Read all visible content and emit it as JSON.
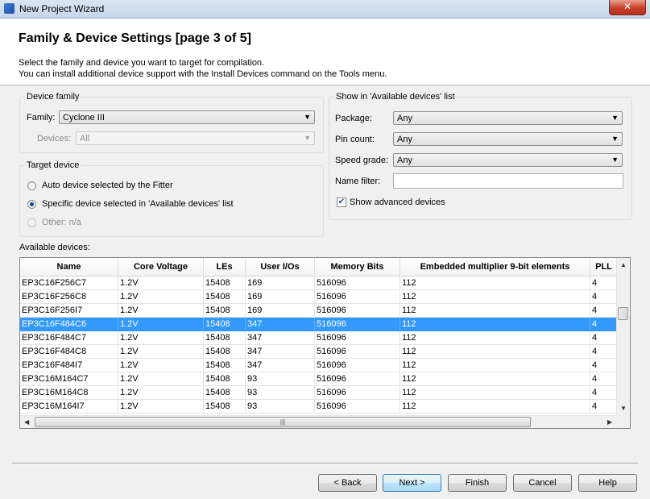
{
  "window": {
    "title": "New Project Wizard",
    "close_glyph": "✕"
  },
  "header": {
    "title": "Family & Device Settings [page 3 of 5]",
    "desc1": "Select the family and device you want to target for compilation.",
    "desc2": "You can install additional device support with the Install Devices command on the Tools menu."
  },
  "device_family": {
    "legend": "Device family",
    "family_label": "Family:",
    "family_value": "Cyclone III",
    "devices_label": "Devices:",
    "devices_value": "All"
  },
  "target_device": {
    "legend": "Target device",
    "auto_label": "Auto device selected by the Fitter",
    "specific_label": "Specific device selected in 'Available devices' list",
    "other_label": "Other:  n/a"
  },
  "show_filter": {
    "legend": "Show in 'Available devices' list",
    "package_label": "Package:",
    "package_value": "Any",
    "pin_label": "Pin count:",
    "pin_value": "Any",
    "speed_label": "Speed grade:",
    "speed_value": "Any",
    "name_filter_label": "Name filter:",
    "name_filter_value": "",
    "advanced_label": "Show advanced devices",
    "advanced_checked": true
  },
  "available_devices": {
    "label": "Available devices:",
    "columns": [
      "Name",
      "Core Voltage",
      "LEs",
      "User I/Os",
      "Memory Bits",
      "Embedded multiplier 9-bit elements",
      "PLL"
    ],
    "rows": [
      [
        "EP3C16F256C7",
        "1.2V",
        "15408",
        "169",
        "516096",
        "112",
        "4"
      ],
      [
        "EP3C16F256C8",
        "1.2V",
        "15408",
        "169",
        "516096",
        "112",
        "4"
      ],
      [
        "EP3C16F256I7",
        "1.2V",
        "15408",
        "169",
        "516096",
        "112",
        "4"
      ],
      [
        "EP3C16F484C6",
        "1.2V",
        "15408",
        "347",
        "516096",
        "112",
        "4"
      ],
      [
        "EP3C16F484C7",
        "1.2V",
        "15408",
        "347",
        "516096",
        "112",
        "4"
      ],
      [
        "EP3C16F484C8",
        "1.2V",
        "15408",
        "347",
        "516096",
        "112",
        "4"
      ],
      [
        "EP3C16F484I7",
        "1.2V",
        "15408",
        "347",
        "516096",
        "112",
        "4"
      ],
      [
        "EP3C16M164C7",
        "1.2V",
        "15408",
        "93",
        "516096",
        "112",
        "4"
      ],
      [
        "EP3C16M164C8",
        "1.2V",
        "15408",
        "93",
        "516096",
        "112",
        "4"
      ],
      [
        "EP3C16M164I7",
        "1.2V",
        "15408",
        "93",
        "516096",
        "112",
        "4"
      ]
    ],
    "selected_row": "EP3C16F484C6"
  },
  "buttons": {
    "back": "< Back",
    "next": "Next >",
    "finish": "Finish",
    "cancel": "Cancel",
    "help": "Help"
  }
}
